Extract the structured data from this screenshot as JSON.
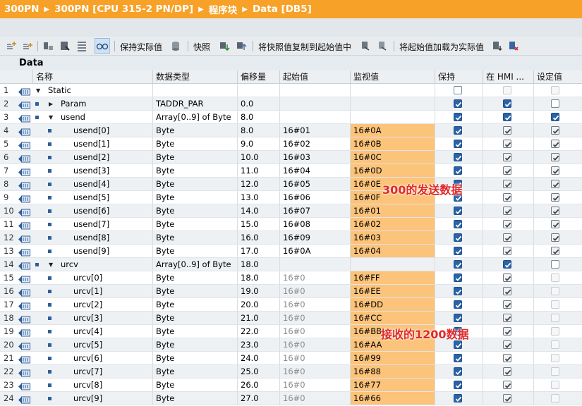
{
  "breadcrumb": [
    "300PN",
    "300PN [CPU 315-2 PN/DP]",
    "程序块",
    "Data [DB5]"
  ],
  "toolbar": {
    "keep_actual": "保持实际值",
    "snapshot": "快照",
    "copy_snapshot": "将快照值复制到起始值中",
    "load_start": "将起始值加载为实际值"
  },
  "grid_title": "Data",
  "columns": {
    "name": "名称",
    "type": "数据类型",
    "offset": "偏移量",
    "start": "起始值",
    "monitor": "监视值",
    "retain": "保持",
    "hmi": "在 HMI ...",
    "setpoint": "设定值"
  },
  "rows": [
    {
      "num": "1",
      "level": 0,
      "expander": "down",
      "name": "Static",
      "type": "",
      "offset": "",
      "start": "",
      "monitor": "",
      "retain": "empty",
      "hmi": "disabled",
      "setpoint": "disabled"
    },
    {
      "num": "2",
      "level": 1,
      "expander": "right",
      "name": "Param",
      "type": "TADDR_PAR",
      "offset": "0.0",
      "start": "",
      "monitor": "",
      "retain": "checked",
      "hmi": "checked",
      "setpoint": "empty"
    },
    {
      "num": "3",
      "level": 1,
      "expander": "down",
      "name": "usend",
      "type": "Array[0..9] of Byte",
      "offset": "8.0",
      "start": "",
      "monitor": "",
      "retain": "checked",
      "hmi": "checked",
      "setpoint": "checked"
    },
    {
      "num": "4",
      "level": 2,
      "name": "usend[0]",
      "type": "Byte",
      "offset": "8.0",
      "start": "16#01",
      "monitor": "16#0A",
      "retain": "checked",
      "hmi": "gray",
      "setpoint": "gray"
    },
    {
      "num": "5",
      "level": 2,
      "name": "usend[1]",
      "type": "Byte",
      "offset": "9.0",
      "start": "16#02",
      "monitor": "16#0B",
      "retain": "checked",
      "hmi": "gray",
      "setpoint": "gray"
    },
    {
      "num": "6",
      "level": 2,
      "name": "usend[2]",
      "type": "Byte",
      "offset": "10.0",
      "start": "16#03",
      "monitor": "16#0C",
      "retain": "checked",
      "hmi": "gray",
      "setpoint": "gray"
    },
    {
      "num": "7",
      "level": 2,
      "name": "usend[3]",
      "type": "Byte",
      "offset": "11.0",
      "start": "16#04",
      "monitor": "16#0D",
      "retain": "checked",
      "hmi": "gray",
      "setpoint": "gray"
    },
    {
      "num": "8",
      "level": 2,
      "name": "usend[4]",
      "type": "Byte",
      "offset": "12.0",
      "start": "16#05",
      "monitor": "16#0E",
      "retain": "checked",
      "hmi": "gray",
      "setpoint": "gray"
    },
    {
      "num": "9",
      "level": 2,
      "name": "usend[5]",
      "type": "Byte",
      "offset": "13.0",
      "start": "16#06",
      "monitor": "16#0F",
      "retain": "checked",
      "hmi": "gray",
      "setpoint": "gray"
    },
    {
      "num": "10",
      "level": 2,
      "name": "usend[6]",
      "type": "Byte",
      "offset": "14.0",
      "start": "16#07",
      "monitor": "16#01",
      "retain": "checked",
      "hmi": "gray",
      "setpoint": "gray"
    },
    {
      "num": "11",
      "level": 2,
      "name": "usend[7]",
      "type": "Byte",
      "offset": "15.0",
      "start": "16#08",
      "monitor": "16#02",
      "retain": "checked",
      "hmi": "gray",
      "setpoint": "gray"
    },
    {
      "num": "12",
      "level": 2,
      "name": "usend[8]",
      "type": "Byte",
      "offset": "16.0",
      "start": "16#09",
      "monitor": "16#03",
      "retain": "checked",
      "hmi": "gray",
      "setpoint": "gray"
    },
    {
      "num": "13",
      "level": 2,
      "name": "usend[9]",
      "type": "Byte",
      "offset": "17.0",
      "start": "16#0A",
      "monitor": "16#04",
      "retain": "checked",
      "hmi": "gray",
      "setpoint": "gray"
    },
    {
      "num": "14",
      "level": 1,
      "expander": "down",
      "name": "urcv",
      "type": "Array[0..9] of Byte",
      "offset": "18.0",
      "start": "",
      "monitor": "",
      "retain": "checked",
      "hmi": "checked",
      "setpoint": "empty"
    },
    {
      "num": "15",
      "level": 2,
      "name": "urcv[0]",
      "type": "Byte",
      "offset": "18.0",
      "start": "16#0",
      "monitor": "16#FF",
      "retain": "checked",
      "hmi": "gray",
      "setpoint": "disabled",
      "start_gray": true
    },
    {
      "num": "16",
      "level": 2,
      "name": "urcv[1]",
      "type": "Byte",
      "offset": "19.0",
      "start": "16#0",
      "monitor": "16#EE",
      "retain": "checked",
      "hmi": "gray",
      "setpoint": "disabled",
      "start_gray": true
    },
    {
      "num": "17",
      "level": 2,
      "name": "urcv[2]",
      "type": "Byte",
      "offset": "20.0",
      "start": "16#0",
      "monitor": "16#DD",
      "retain": "checked",
      "hmi": "gray",
      "setpoint": "disabled",
      "start_gray": true
    },
    {
      "num": "18",
      "level": 2,
      "name": "urcv[3]",
      "type": "Byte",
      "offset": "21.0",
      "start": "16#0",
      "monitor": "16#CC",
      "retain": "checked",
      "hmi": "gray",
      "setpoint": "disabled",
      "start_gray": true
    },
    {
      "num": "19",
      "level": 2,
      "name": "urcv[4]",
      "type": "Byte",
      "offset": "22.0",
      "start": "16#0",
      "monitor": "16#BB",
      "retain": "checked",
      "hmi": "gray",
      "setpoint": "disabled",
      "start_gray": true
    },
    {
      "num": "20",
      "level": 2,
      "name": "urcv[5]",
      "type": "Byte",
      "offset": "23.0",
      "start": "16#0",
      "monitor": "16#AA",
      "retain": "checked",
      "hmi": "gray",
      "setpoint": "disabled",
      "start_gray": true
    },
    {
      "num": "21",
      "level": 2,
      "name": "urcv[6]",
      "type": "Byte",
      "offset": "24.0",
      "start": "16#0",
      "monitor": "16#99",
      "retain": "checked",
      "hmi": "gray",
      "setpoint": "disabled",
      "start_gray": true
    },
    {
      "num": "22",
      "level": 2,
      "name": "urcv[7]",
      "type": "Byte",
      "offset": "25.0",
      "start": "16#0",
      "monitor": "16#88",
      "retain": "checked",
      "hmi": "gray",
      "setpoint": "disabled",
      "start_gray": true
    },
    {
      "num": "23",
      "level": 2,
      "name": "urcv[8]",
      "type": "Byte",
      "offset": "26.0",
      "start": "16#0",
      "monitor": "16#77",
      "retain": "checked",
      "hmi": "gray",
      "setpoint": "disabled",
      "start_gray": true
    },
    {
      "num": "24",
      "level": 2,
      "name": "urcv[9]",
      "type": "Byte",
      "offset": "27.0",
      "start": "16#0",
      "monitor": "16#66",
      "retain": "checked",
      "hmi": "gray",
      "setpoint": "disabled",
      "start_gray": true
    }
  ],
  "annotations": {
    "send": "300的发送数据",
    "receive": "接收的1200数据"
  },
  "colors": {
    "title_bar": "#f7a128",
    "monitor_highlight": "#fcc37a",
    "checkbox_checked": "#2a63a8",
    "annotation": "#e0292a"
  }
}
